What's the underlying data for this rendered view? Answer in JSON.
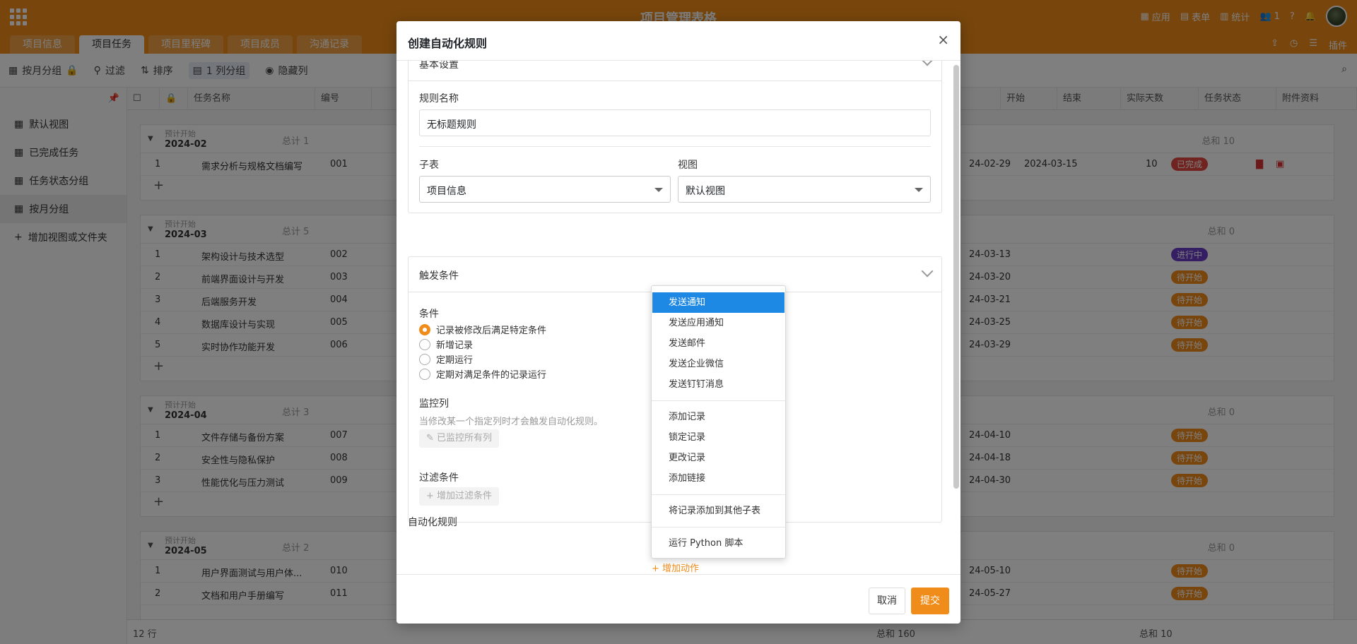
{
  "app": {
    "title": "项目管理表格",
    "top_right": [
      "应用",
      "表单",
      "统计",
      "1"
    ],
    "tabs": [
      "项目信息",
      "项目任务",
      "项目里程碑",
      "项目成员",
      "沟通记录"
    ],
    "active_tab": "项目任务",
    "tab_right": "插件"
  },
  "toolbar": {
    "items": [
      "按月分组",
      "过滤",
      "排序",
      "1 列分组",
      "隐藏列"
    ]
  },
  "sidebar": {
    "items": [
      "默认视图",
      "已完成任务",
      "任务状态分组",
      "按月分组"
    ],
    "add_label": "增加视图或文件夹"
  },
  "grid": {
    "columns": [
      "任务名称",
      "编号",
      "开始",
      "结束",
      "实际天数",
      "任务状态",
      "附件资料"
    ],
    "groups": [
      {
        "label": "预计开始",
        "month": "2024-02",
        "count": "总计 1",
        "sum": "总和 10",
        "rows": [
          {
            "n": "1",
            "name": "需求分析与规格文档编写",
            "code": "001",
            "start": "24-02-29",
            "end": "2024-03-15",
            "days": "10",
            "status": "已完成"
          }
        ]
      },
      {
        "label": "预计开始",
        "month": "2024-03",
        "count": "总计 5",
        "sum": "总和 0",
        "rows": [
          {
            "n": "1",
            "name": "架构设计与技术选型",
            "code": "002",
            "start": "24-03-13",
            "status": "进行中"
          },
          {
            "n": "2",
            "name": "前端界面设计与开发",
            "code": "003",
            "start": "24-03-20",
            "status": "待开始"
          },
          {
            "n": "3",
            "name": "后端服务开发",
            "code": "004",
            "start": "24-03-21",
            "status": "待开始"
          },
          {
            "n": "4",
            "name": "数据库设计与实现",
            "code": "005",
            "start": "24-03-25",
            "status": "待开始"
          },
          {
            "n": "5",
            "name": "实时协作功能开发",
            "code": "006",
            "start": "24-03-29",
            "status": "待开始"
          }
        ]
      },
      {
        "label": "预计开始",
        "month": "2024-04",
        "count": "总计 3",
        "sum": "总和 0",
        "rows": [
          {
            "n": "1",
            "name": "文件存储与备份方案",
            "code": "007",
            "start": "24-04-10",
            "status": "待开始"
          },
          {
            "n": "2",
            "name": "安全性与隐私保护",
            "code": "008",
            "start": "24-04-18",
            "status": "待开始"
          },
          {
            "n": "3",
            "name": "性能优化与压力测试",
            "code": "009",
            "start": "24-04-30",
            "status": "待开始"
          }
        ]
      },
      {
        "label": "预计开始",
        "month": "2024-05",
        "count": "总计 2",
        "sum": "总和 0",
        "rows": [
          {
            "n": "1",
            "name": "用户界面测试与用户体...",
            "code": "010",
            "start": "24-05-10",
            "status": "待开始"
          },
          {
            "n": "2",
            "name": "文档和用户手册编写",
            "code": "011",
            "start": "24-05-27",
            "status": "待开始"
          }
        ]
      }
    ],
    "footer_rows": "12 行",
    "footer_sum1": "总和 160",
    "footer_sum2": "总和 10"
  },
  "modal": {
    "title": "创建自动化规则",
    "close": "×",
    "basic_section": "基本设置",
    "rule_name_label": "规则名称",
    "rule_name_value": "无标题规则",
    "table_label": "子表",
    "table_value": "项目信息",
    "view_label": "视图",
    "view_value": "默认视图",
    "trigger_section": "触发条件",
    "condition_label": "条件",
    "conditions": [
      "记录被修改后满足特定条件",
      "新增记录",
      "定期运行",
      "定期对满足条件的记录运行"
    ],
    "monitor_label": "监控列",
    "monitor_hint": "当修改某一个指定列时才会触发自动化规则。",
    "monitor_button": "已监控所有列",
    "filter_label": "过滤条件",
    "filter_button": "增加过滤条件",
    "auto_label": "自动化规则",
    "add_action": "+ 增加动作",
    "cancel": "取消",
    "submit": "提交"
  },
  "dropdown": {
    "group1": [
      "发送通知",
      "发送应用通知",
      "发送邮件",
      "发送企业微信",
      "发送钉钉消息"
    ],
    "group2": [
      "添加记录",
      "锁定记录",
      "更改记录",
      "添加链接"
    ],
    "group3": [
      "将记录添加到其他子表"
    ],
    "group4": [
      "运行 Python 脚本"
    ],
    "selected": "发送通知"
  },
  "colors": {
    "brand": "#f08c19",
    "select": "#1e88e5",
    "done": "#e0463e",
    "doing": "#6a3dc6"
  }
}
